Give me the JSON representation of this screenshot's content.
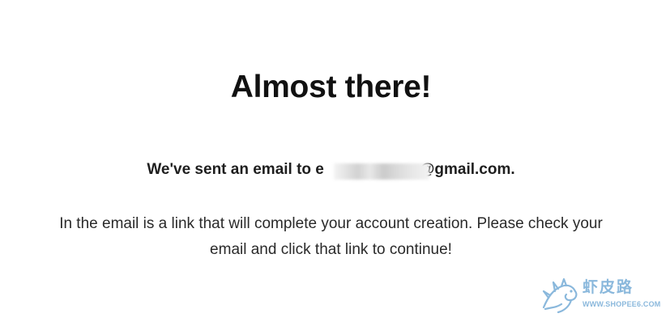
{
  "heading": "Almost there!",
  "sent_message": {
    "prefix": "We've sent an email to e",
    "email_suffix": "@gmail.com."
  },
  "instructions": {
    "line1": "In the email is a link that will complete your account creation. Please check your",
    "line2": "email and click that link to continue!"
  },
  "watermark": {
    "title": "虾皮路",
    "url": "WWW.SHOPEE6.COM",
    "color": "#8ab8dc"
  }
}
